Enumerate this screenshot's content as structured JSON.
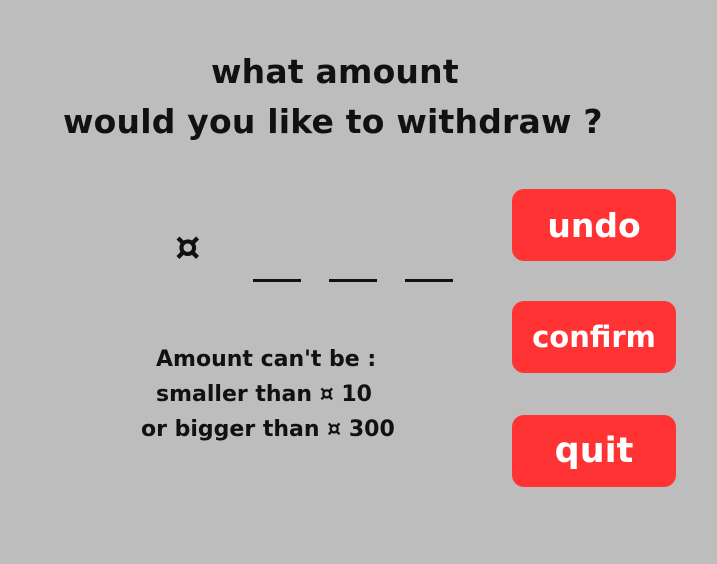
{
  "prompt": {
    "line1": "what amount",
    "line2": "would you like to withdraw ?"
  },
  "amount_entry": {
    "currency_symbol": "¤",
    "digit_slots": [
      "",
      "",
      ""
    ]
  },
  "limits": {
    "line1": "Amount can't be :",
    "line2": "smaller than ¤ 10",
    "line3": "or bigger  than ¤ 300"
  },
  "buttons": {
    "undo": "undo",
    "confirm": "confirm",
    "quit": "quit"
  },
  "colors": {
    "background": "#bdbdbd",
    "button": "#ff3333",
    "button_text": "#ffffff",
    "text": "#111111"
  }
}
